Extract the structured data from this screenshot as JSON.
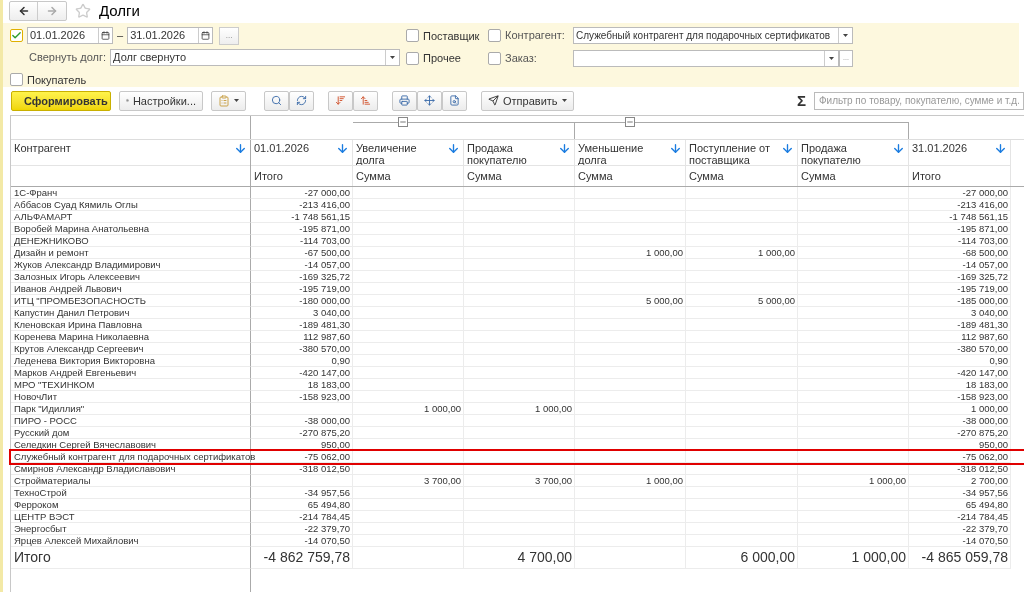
{
  "title": "Долги",
  "filters": {
    "period": {
      "checked": true,
      "date_from": "01.01.2026",
      "separator": "–",
      "date_to": "31.01.2026",
      "more": "..."
    },
    "collapse": {
      "label": "Свернуть долг:",
      "value": "Долг свернуто"
    },
    "checkboxes": [
      {
        "label": "Поставщик",
        "checked": false
      },
      {
        "label": "Прочее",
        "checked": false
      },
      {
        "label": "Покупатель",
        "checked": false
      }
    ],
    "counterparty": {
      "label": "Контрагент:",
      "checked": false,
      "value": "Служебный контрагент для подарочных сертификатов"
    },
    "order": {
      "label": "Заказ:",
      "checked": false,
      "more": "..."
    }
  },
  "toolbar": {
    "generate": "Сформировать",
    "settings": "Настройки...",
    "send": "Отправить",
    "sigma": "Σ",
    "search_placeholder": "Фильтр по товару, покупателю, сумме и т.д."
  },
  "table": {
    "columns": [
      {
        "title": "Контрагент"
      },
      {
        "title": "01.01.2026",
        "subtitle": "Итого"
      },
      {
        "title": "Увеличение долга",
        "subtitle": "Сумма"
      },
      {
        "title": "Продажа покупателю",
        "subtitle": "Сумма"
      },
      {
        "title": "Уменьшение долга",
        "subtitle": "Сумма"
      },
      {
        "title": "Поступление от поставщика",
        "subtitle": "Сумма"
      },
      {
        "title": "Продажа покупателю",
        "subtitle": "Сумма"
      },
      {
        "title": "31.01.2026",
        "subtitle": "Итого"
      }
    ],
    "rows": [
      {
        "name": "1С-Франч",
        "opening": "-27 000,00",
        "closing": "-27 000,00",
        "highlighted": false
      },
      {
        "name": "Аббасов Суад Кямиль Оглы",
        "opening": "-213 416,00",
        "closing": "-213 416,00",
        "highlighted": false
      },
      {
        "name": "АЛЬФАМАРТ",
        "opening": "-1 748 561,15",
        "closing": "-1 748 561,15",
        "highlighted": false
      },
      {
        "name": "Воробей Марина Анатольевна",
        "opening": "-195 871,00",
        "closing": "-195 871,00",
        "highlighted": false
      },
      {
        "name": "ДЕНЕЖНИКОВО",
        "opening": "-114 703,00",
        "closing": "-114 703,00",
        "highlighted": false
      },
      {
        "name": "Дизайн и ремонт",
        "opening": "-67 500,00",
        "debt_decrease": "1 000,00",
        "supplier_receipt": "1 000,00",
        "closing": "-68 500,00",
        "highlighted": false
      },
      {
        "name": "Жуков Александр Владимирович",
        "opening": "-14 057,00",
        "closing": "-14 057,00",
        "highlighted": false
      },
      {
        "name": "Залозных Игорь Алексеевич",
        "opening": "-169 325,72",
        "closing": "-169 325,72",
        "highlighted": false
      },
      {
        "name": "Иванов Андрей Львович",
        "opening": "-195 719,00",
        "closing": "-195 719,00",
        "highlighted": false
      },
      {
        "name": "ИТЦ \"ПРОМБЕЗОПАСНОСТЬ",
        "opening": "-180 000,00",
        "debt_decrease": "5 000,00",
        "supplier_receipt": "5 000,00",
        "closing": "-185 000,00",
        "highlighted": false
      },
      {
        "name": "Капустин Данил Петрович",
        "opening": "3 040,00",
        "closing": "3 040,00",
        "highlighted": false
      },
      {
        "name": "Кленовская Ирина Павловна",
        "opening": "-189 481,30",
        "closing": "-189 481,30",
        "highlighted": false
      },
      {
        "name": "Коренева Марина Николаевна",
        "opening": "112 987,60",
        "closing": "112 987,60",
        "highlighted": false
      },
      {
        "name": "Крутов Александр Сергеевич",
        "opening": "-380 570,00",
        "closing": "-380 570,00",
        "highlighted": false
      },
      {
        "name": "Леденева Виктория Викторовна",
        "opening": "0,90",
        "closing": "0,90",
        "highlighted": false
      },
      {
        "name": "Марков Андрей Евгеньевич",
        "opening": "-420 147,00",
        "closing": "-420 147,00",
        "highlighted": false
      },
      {
        "name": "МРО \"ТЕХИНКОМ",
        "opening": "18 183,00",
        "closing": "18 183,00",
        "highlighted": false
      },
      {
        "name": "НовочЛит",
        "opening": "-158 923,00",
        "closing": "-158 923,00",
        "highlighted": false
      },
      {
        "name": "Парк \"Идиллия\"",
        "debt_increase": "1 000,00",
        "sale_to_buyer": "1 000,00",
        "closing": "1 000,00",
        "highlighted": false
      },
      {
        "name": "ПИРО - РОСС",
        "opening": "-38 000,00",
        "closing": "-38 000,00",
        "highlighted": false
      },
      {
        "name": "Русский дом",
        "opening": "-270 875,20",
        "closing": "-270 875,20",
        "highlighted": false
      },
      {
        "name": "Селедкин Сергей Вячеславович",
        "opening": "950,00",
        "closing": "950,00",
        "highlighted": false
      },
      {
        "name": "Служебный контрагент для подарочных сертификатов",
        "opening": "-75 062,00",
        "closing": "-75 062,00",
        "highlighted": true
      },
      {
        "name": "Смирнов Александр Владиславович",
        "opening": "-318 012,50",
        "closing": "-318 012,50",
        "highlighted": false
      },
      {
        "name": "Стройматериалы",
        "debt_increase": "3 700,00",
        "sale_to_buyer": "3 700,00",
        "debt_decrease": "1 000,00",
        "sale_to_buyer_2": "1 000,00",
        "closing": "2 700,00",
        "highlighted": false
      },
      {
        "name": "ТехноСтрой",
        "opening": "-34 957,56",
        "closing": "-34 957,56",
        "highlighted": false
      },
      {
        "name": "Ферроком",
        "opening": "65 494,80",
        "closing": "65 494,80",
        "highlighted": false
      },
      {
        "name": "ЦЕНТР ВЭСТ",
        "opening": "-214 784,45",
        "closing": "-214 784,45",
        "highlighted": false
      },
      {
        "name": "Энергосбыт",
        "opening": "-22 379,70",
        "closing": "-22 379,70",
        "highlighted": false
      },
      {
        "name": "Ярцев Алексей Михайлович",
        "opening": "-14 070,50",
        "closing": "-14 070,50",
        "highlighted": false
      }
    ],
    "total": {
      "name": "Итого",
      "opening": "-4 862 759,78",
      "sale_to_buyer": "4 700,00",
      "supplier_receipt": "6 000,00",
      "sale_to_buyer_2": "1 000,00",
      "closing": "-4 865 059,78"
    }
  }
}
